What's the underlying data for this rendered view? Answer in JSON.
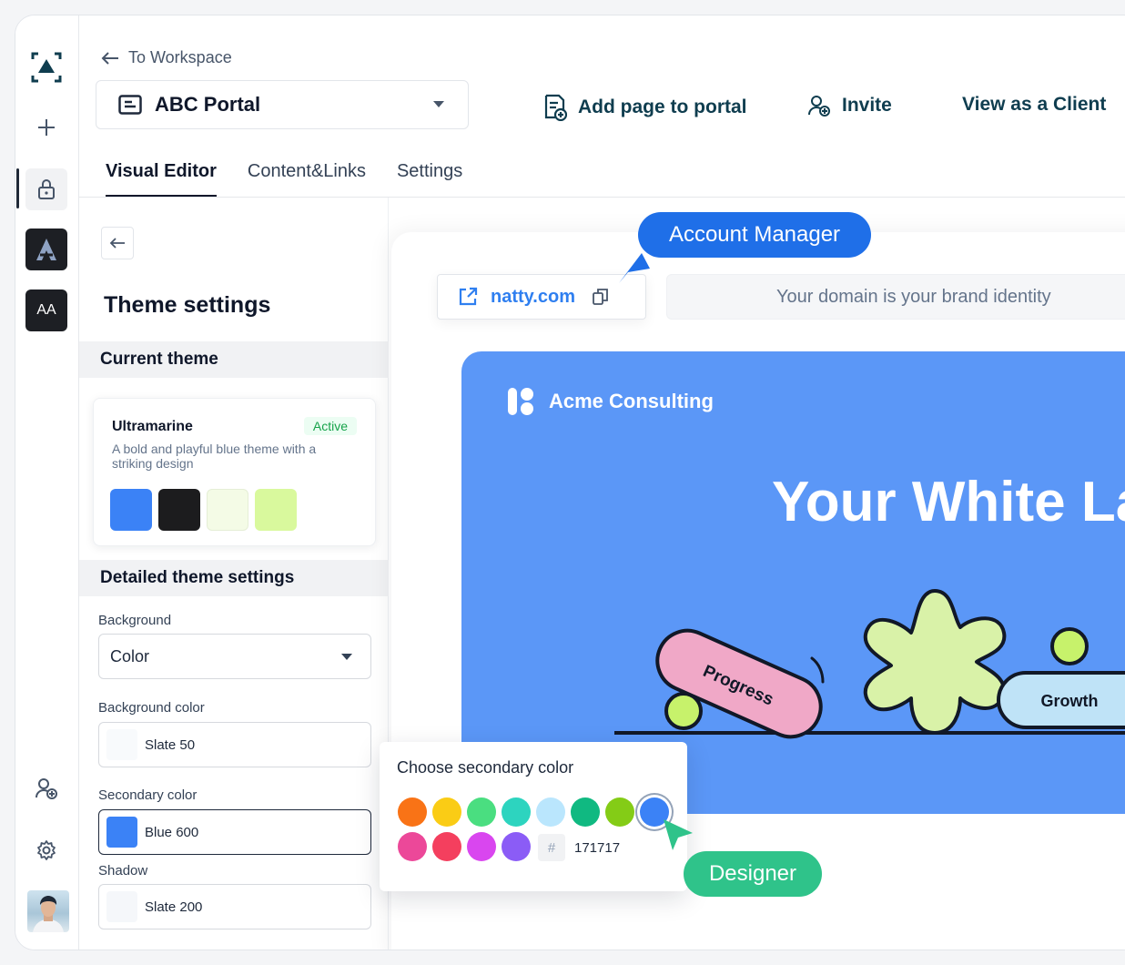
{
  "header": {
    "back_link": "To Workspace",
    "portal_name": "ABC Portal",
    "actions": {
      "add_page": "Add page to portal",
      "invite": "Invite",
      "view_as_client": "View as a Client"
    }
  },
  "tabs": [
    {
      "label": "Visual Editor",
      "active": true
    },
    {
      "label": "Content&Links",
      "active": false
    },
    {
      "label": "Settings",
      "active": false
    }
  ],
  "rail": {
    "tile_label": "AA"
  },
  "panel": {
    "title": "Theme settings",
    "current_theme_heading": "Current theme",
    "theme": {
      "name": "Ultramarine",
      "badge": "Active",
      "description": "A bold and playful blue theme with a striking design",
      "swatches": [
        "#3b82f6",
        "#1c1c1e",
        "#f4fbe6",
        "#d9f99d"
      ]
    },
    "detailed_heading": "Detailed theme settings",
    "background_label": "Background",
    "background_value": "Color",
    "background_color_label": "Background color",
    "background_color_value": "Slate 50",
    "secondary_color_label": "Secondary color",
    "secondary_color_value": "Blue 600",
    "shadow_label": "Shadow",
    "shadow_value": "Slate 200"
  },
  "preview": {
    "domain": "natty.com",
    "domain_hint": "Your domain is your brand identity",
    "brand": "Acme Consulting",
    "hero_title": "Your White La",
    "shape_labels": [
      "Progress",
      "Growth"
    ]
  },
  "picker": {
    "title": "Choose secondary color",
    "colors_row1": [
      "#f97316",
      "#facc15",
      "#4ade80",
      "#2dd4bf",
      "#bae6fd",
      "#10b981",
      "#84cc16",
      "#3b82f6"
    ],
    "colors_row2": [
      "#ec4899",
      "#f43f5e",
      "#d946ef",
      "#8b5cf6"
    ],
    "selected_color": "#3b82f6",
    "hex_prefix": "#",
    "hex_value": "171717"
  },
  "callouts": {
    "account_manager": "Account Manager",
    "designer": "Designer"
  },
  "colors": {
    "accent_dark": "#0f3d4f",
    "brand_blue": "#1f6fe8",
    "hero_blue": "#5b97f7",
    "callout_green": "#2fc38a"
  }
}
